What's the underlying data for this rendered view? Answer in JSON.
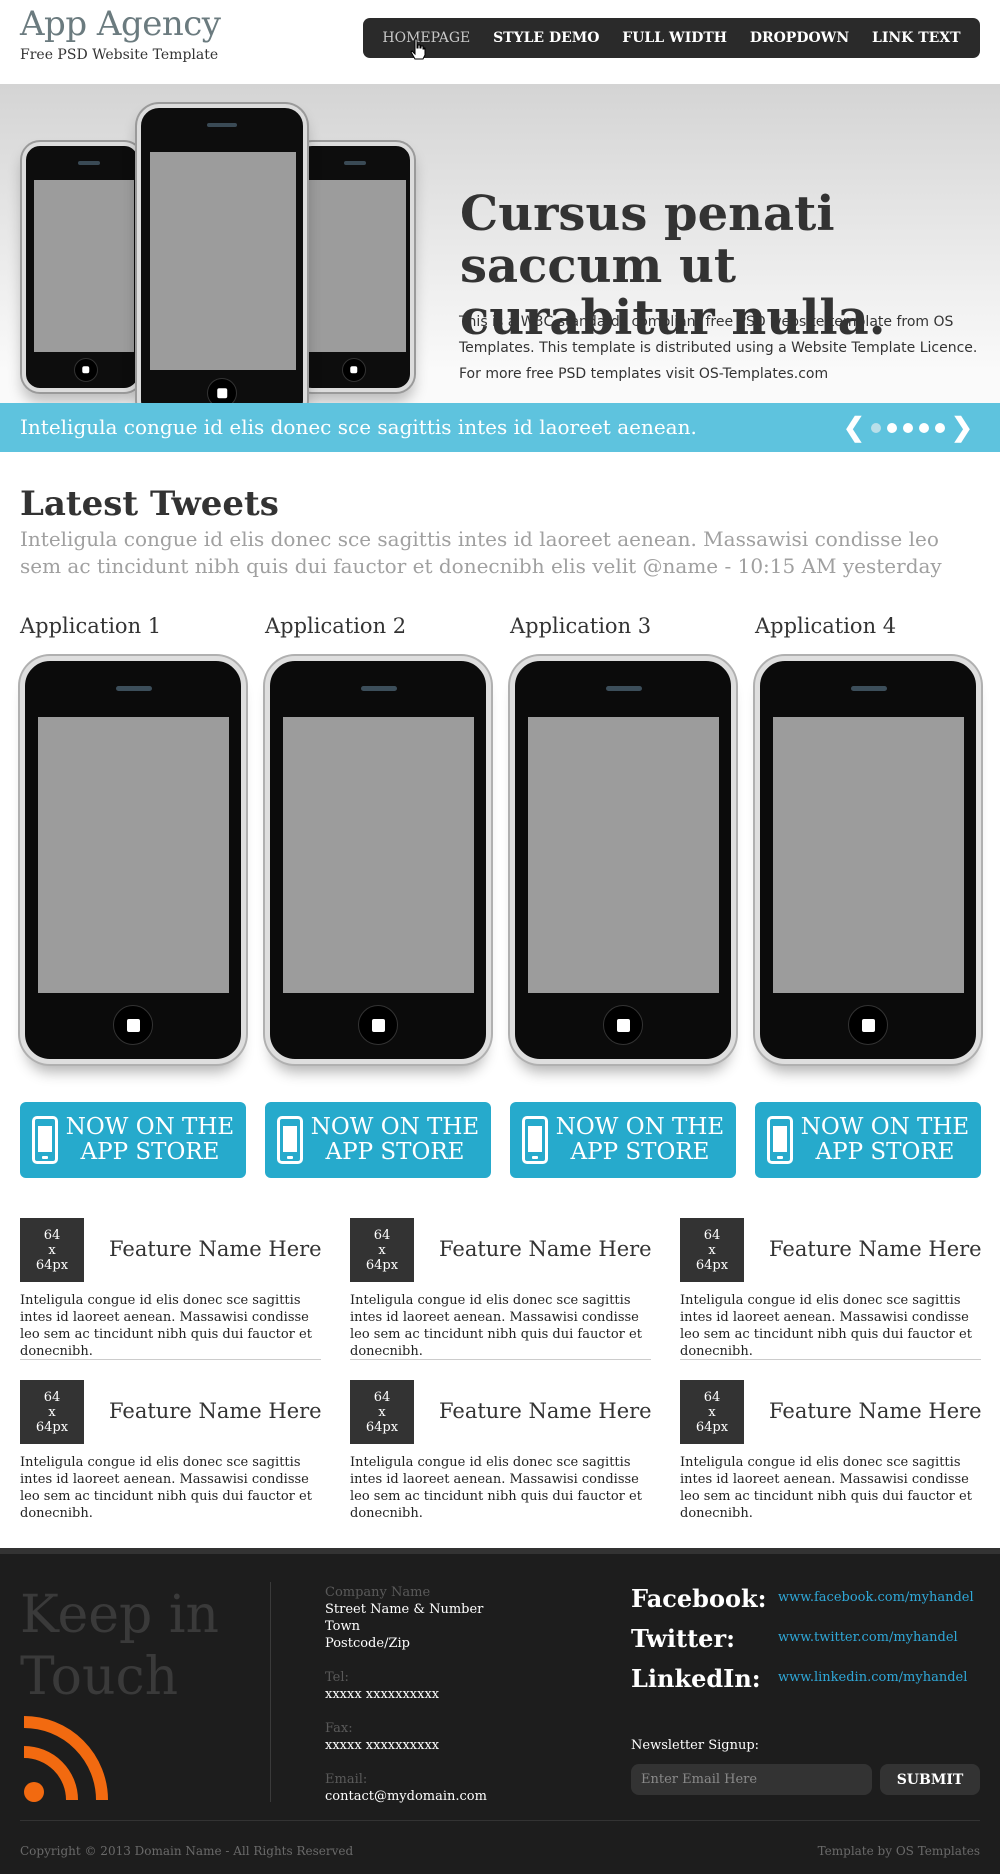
{
  "header": {
    "title": "App Agency",
    "subtitle": "Free PSD Website Template"
  },
  "nav": {
    "items": [
      {
        "label": "HOMEPAGE",
        "active": true
      },
      {
        "label": "STYLE DEMO",
        "active": false
      },
      {
        "label": "FULL WIDTH",
        "active": false
      },
      {
        "label": "DROPDOWN",
        "active": false
      },
      {
        "label": "LINK TEXT",
        "active": false
      }
    ]
  },
  "hero": {
    "heading": "Cursus penati saccum ut curabitur nulla.",
    "text": "This is a W3C standards compliant free PSD website template from OS Templates. This template is distributed using a Website Template Licence. For more free PSD templates visit OS-Templates.com",
    "strip_text": "Inteligula congue id elis donec sce sagittis intes id laoreet aenean.",
    "slider": {
      "prev_icon": "chevron-left-icon",
      "next_icon": "chevron-right-icon",
      "dot_count": 5,
      "active_dot": 1
    }
  },
  "tweets": {
    "title": "Latest Tweets",
    "text": "Inteligula congue id elis donec sce sagittis intes id laoreet aenean. Massawisi condisse leo sem ac tincidunt nibh quis dui fauctor et donecnibh elis velit @name - 10:15 AM yesterday"
  },
  "apps": [
    {
      "title": "Application 1",
      "button_label": "NOW ON THE APP STORE"
    },
    {
      "title": "Application 2",
      "button_label": "NOW ON THE APP STORE"
    },
    {
      "title": "Application 3",
      "button_label": "NOW ON THE APP STORE"
    },
    {
      "title": "Application 4",
      "button_label": "NOW ON THE APP STORE"
    }
  ],
  "features": [
    {
      "icon_line1": "64",
      "icon_line2": "x",
      "icon_line3": "64px",
      "name": "Feature Name Here",
      "desc": "Inteligula congue id elis donec sce sagittis intes id laoreet aenean. Massawisi condisse leo sem ac tincidunt nibh quis dui fauctor et donecnibh."
    },
    {
      "icon_line1": "64",
      "icon_line2": "x",
      "icon_line3": "64px",
      "name": "Feature Name Here",
      "desc": "Inteligula congue id elis donec sce sagittis intes id laoreet aenean. Massawisi condisse leo sem ac tincidunt nibh quis dui fauctor et donecnibh."
    },
    {
      "icon_line1": "64",
      "icon_line2": "x",
      "icon_line3": "64px",
      "name": "Feature Name Here",
      "desc": "Inteligula congue id elis donec sce sagittis intes id laoreet aenean. Massawisi condisse leo sem ac tincidunt nibh quis dui fauctor et donecnibh."
    },
    {
      "icon_line1": "64",
      "icon_line2": "x",
      "icon_line3": "64px",
      "name": "Feature Name Here",
      "desc": "Inteligula congue id elis donec sce sagittis intes id laoreet aenean. Massawisi condisse leo sem ac tincidunt nibh quis dui fauctor et donecnibh."
    },
    {
      "icon_line1": "64",
      "icon_line2": "x",
      "icon_line3": "64px",
      "name": "Feature Name Here",
      "desc": "Inteligula congue id elis donec sce sagittis intes id laoreet aenean. Massawisi condisse leo sem ac tincidunt nibh quis dui fauctor et donecnibh."
    },
    {
      "icon_line1": "64",
      "icon_line2": "x",
      "icon_line3": "64px",
      "name": "Feature Name Here",
      "desc": "Inteligula congue id elis donec sce sagittis intes id laoreet aenean. Massawisi condisse leo sem ac tincidunt nibh quis dui fauctor et donecnibh."
    }
  ],
  "footer": {
    "heading": "Keep in Touch",
    "contact": {
      "company": "Company Name",
      "street": "Street Name & Number",
      "town": "Town",
      "postcode": "Postcode/Zip",
      "tel_label": "Tel:",
      "tel": "xxxxx xxxxxxxxxx",
      "fax_label": "Fax:",
      "fax": "xxxxx xxxxxxxxxx",
      "email_label": "Email:",
      "email": "contact@mydomain.com"
    },
    "social": [
      {
        "name": "Facebook:",
        "url": "www.facebook.com/myhandel"
      },
      {
        "name": "Twitter:",
        "url": "www.twitter.com/myhandel"
      },
      {
        "name": "LinkedIn:",
        "url": "www.linkedin.com/myhandel"
      }
    ],
    "newsletter": {
      "label": "Newsletter Signup:",
      "placeholder": "Enter Email Here",
      "submit": "SUBMIT"
    },
    "copyright": "Copyright © 2013 Domain Name - All Rights Reserved",
    "credit": "Template by OS Templates"
  },
  "colors": {
    "accent": "#26aacc",
    "strip": "#5ec3de",
    "nav_bg": "#2a2a2a",
    "footer_bg": "#1d1d1d",
    "rss": "#f26a10"
  }
}
